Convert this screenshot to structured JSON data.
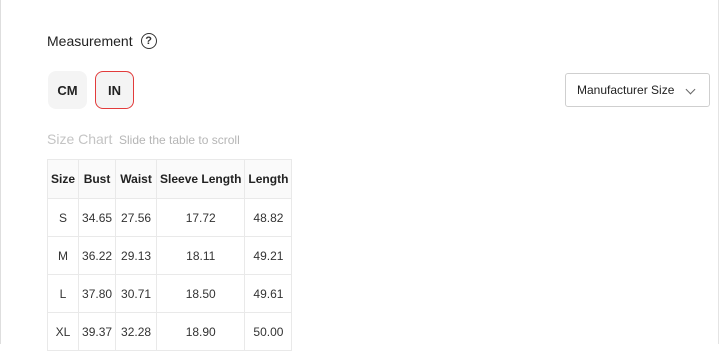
{
  "measurement": {
    "heading": "Measurement",
    "help_icon": "?"
  },
  "units": {
    "cm_label": "CM",
    "in_label": "IN",
    "selected": "IN"
  },
  "size_select": {
    "value": "Manufacturer Size"
  },
  "size_chart": {
    "title": "Size Chart",
    "hint": "Slide the table to scroll",
    "headers": [
      "Size",
      "Bust",
      "Waist",
      "Sleeve Length",
      "Length"
    ],
    "rows": [
      [
        "S",
        "34.65",
        "27.56",
        "17.72",
        "48.82"
      ],
      [
        "M",
        "36.22",
        "29.13",
        "18.11",
        "49.21"
      ],
      [
        "L",
        "37.80",
        "30.71",
        "18.50",
        "49.61"
      ],
      [
        "XL",
        "39.37",
        "32.28",
        "18.90",
        "50.00"
      ]
    ]
  },
  "colors": {
    "selected_border": "#e23b3b",
    "chip_bg": "#f4f4f4",
    "muted_text": "#c4c4c4"
  }
}
